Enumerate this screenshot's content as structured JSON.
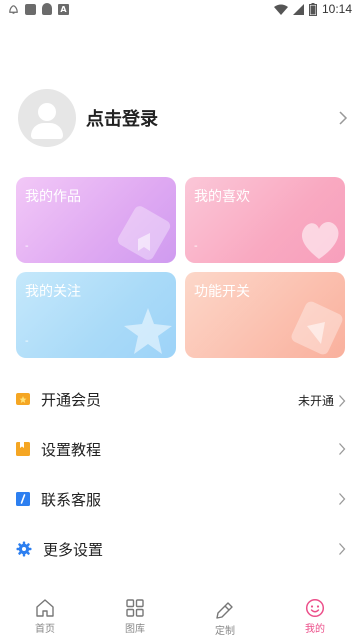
{
  "status_bar": {
    "time": "10:14",
    "icons": [
      "notification-icon",
      "image-icon",
      "storage-icon",
      "a-icon",
      "wifi-icon",
      "signal-icon",
      "battery-icon"
    ]
  },
  "profile": {
    "login_label": "点击登录",
    "icon": "avatar-placeholder-icon"
  },
  "cards": [
    {
      "title": "我的作品",
      "sub": "-",
      "colors": [
        "#f2c8f7",
        "#cf9bf0"
      ]
    },
    {
      "title": "我的喜欢",
      "sub": "-",
      "colors": [
        "#fbc7d8",
        "#f79fbc"
      ]
    },
    {
      "title": "我的关注",
      "sub": "-",
      "colors": [
        "#c5e8fb",
        "#9dd3f8"
      ]
    },
    {
      "title": "功能开关",
      "sub": "",
      "colors": [
        "#fcd7c9",
        "#f9b09d"
      ]
    }
  ],
  "menu": [
    {
      "label": "开通会员",
      "status": "未开通",
      "icon": "vip-icon",
      "color": "#f5a623"
    },
    {
      "label": "设置教程",
      "status": "",
      "icon": "tutorial-icon",
      "color": "#f5a623"
    },
    {
      "label": "联系客服",
      "status": "",
      "icon": "service-icon",
      "color": "#2d7ff0"
    },
    {
      "label": "更多设置",
      "status": "",
      "icon": "settings-icon",
      "color": "#2d7ff0"
    }
  ],
  "bottom_nav": [
    {
      "label": "首页",
      "icon": "home-icon"
    },
    {
      "label": "图库",
      "icon": "gallery-icon"
    },
    {
      "label": "定制",
      "icon": "customize-icon"
    },
    {
      "label": "我的",
      "icon": "profile-icon",
      "active": true
    }
  ],
  "colors": {
    "accent": "#ec4f8a",
    "text": "#222222",
    "muted": "#888888"
  }
}
